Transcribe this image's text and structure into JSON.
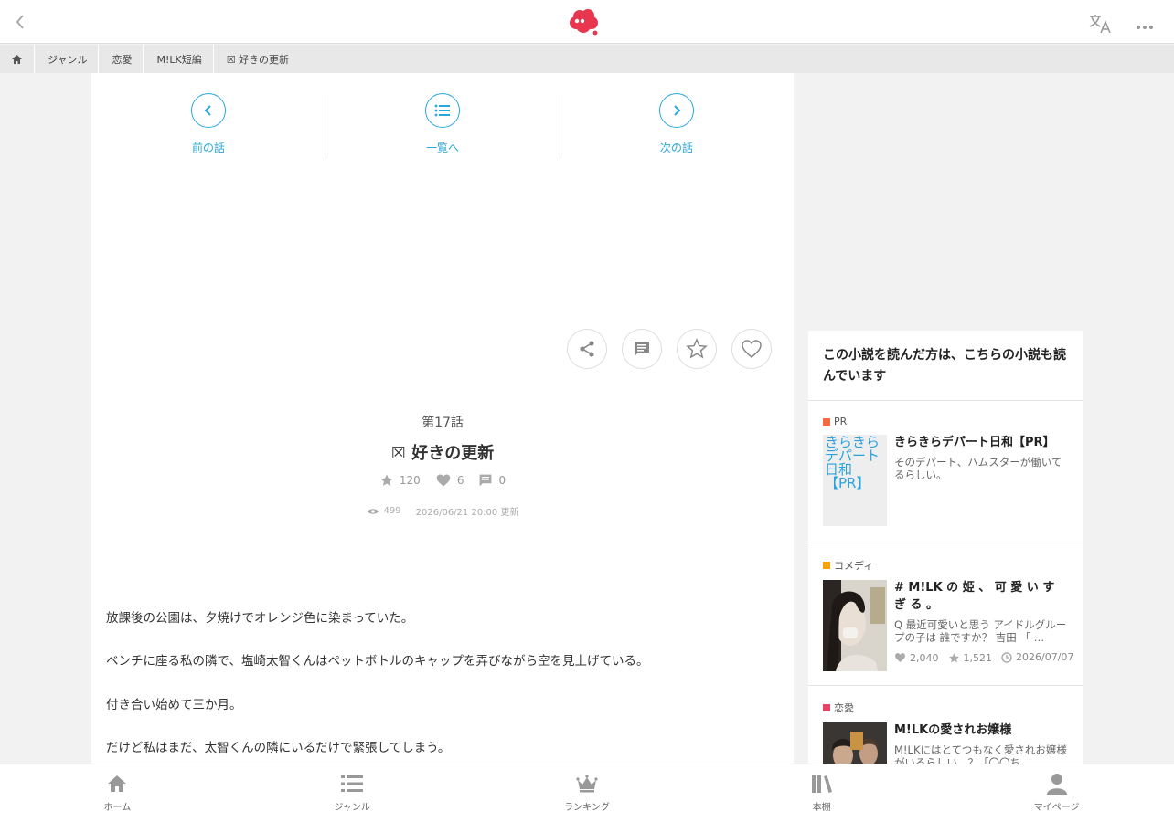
{
  "header": {
    "icons": {
      "back": "chevron-left-icon",
      "logo": "cloud-logo",
      "translate": "translate-icon",
      "more": "more-horizontal-icon"
    },
    "logo_color": "#e8364f"
  },
  "breadcrumb": {
    "home_icon": "home-icon",
    "items": [
      {
        "label": "ジャンル"
      },
      {
        "label": "恋愛"
      },
      {
        "label": "M!LK短編"
      },
      {
        "label": "☒ 好きの更新"
      }
    ]
  },
  "episode_nav": {
    "prev_label": "前の話",
    "list_label": "一覧へ",
    "next_label": "次の話",
    "accent": "#29a8dc"
  },
  "actions": {
    "icons": [
      "share-icon",
      "comment-icon",
      "star-icon",
      "heart-icon"
    ]
  },
  "episode": {
    "number": "第17話",
    "title": "☒ 好きの更新",
    "stars": "120",
    "likes": "6",
    "comments": "0",
    "views": "499",
    "updated": "2026/06/21 20:00 更新"
  },
  "body": {
    "paragraphs": [
      "放課後の公園は、夕焼けでオレンジ色に染まっていた。",
      "ベンチに座る私の隣で、塩崎太智くんはペットボトルのキャップを弄びながら空を見上げている。",
      "付き合い始めて三か月。",
      "だけど私はまだ、太智くんの隣にいるだけで緊張してしまう。"
    ]
  },
  "sidebar": {
    "heading": "この小説を読んだ方は、こちらの小説も読んでいます",
    "recommendations": [
      {
        "genre": "PR",
        "genre_color": "#f26a3d",
        "thumb_text": "きらきらデパート日和【PR】",
        "title": "きらきらデパート日和【PR】",
        "desc": "そのデパート、ハムスターが働いてるらしい。"
      },
      {
        "genre": "コメディ",
        "genre_color": "#f5a100",
        "title": "# M!LK の 姫 、 可 愛 い す ぎ る 。",
        "desc": "Q 最近可愛いと思う アイドルグループの子は 誰ですか？ 吉田 「 …",
        "likes": "2,040",
        "stars": "1,521",
        "date": "2026/07/07"
      },
      {
        "genre": "恋愛",
        "genre_color": "#e8436a",
        "title": "M!LKの愛されお嬢様",
        "desc": "M!LKにはとてつもなく愛されお嬢様がいるらしい…？「〇〇ち"
      }
    ]
  },
  "tabbar": {
    "items": [
      {
        "label": "ホーム",
        "icon": "home-icon"
      },
      {
        "label": "ジャンル",
        "icon": "list-icon"
      },
      {
        "label": "ランキング",
        "icon": "crown-icon"
      },
      {
        "label": "本棚",
        "icon": "bookshelf-icon"
      },
      {
        "label": "マイページ",
        "icon": "user-icon"
      }
    ]
  }
}
